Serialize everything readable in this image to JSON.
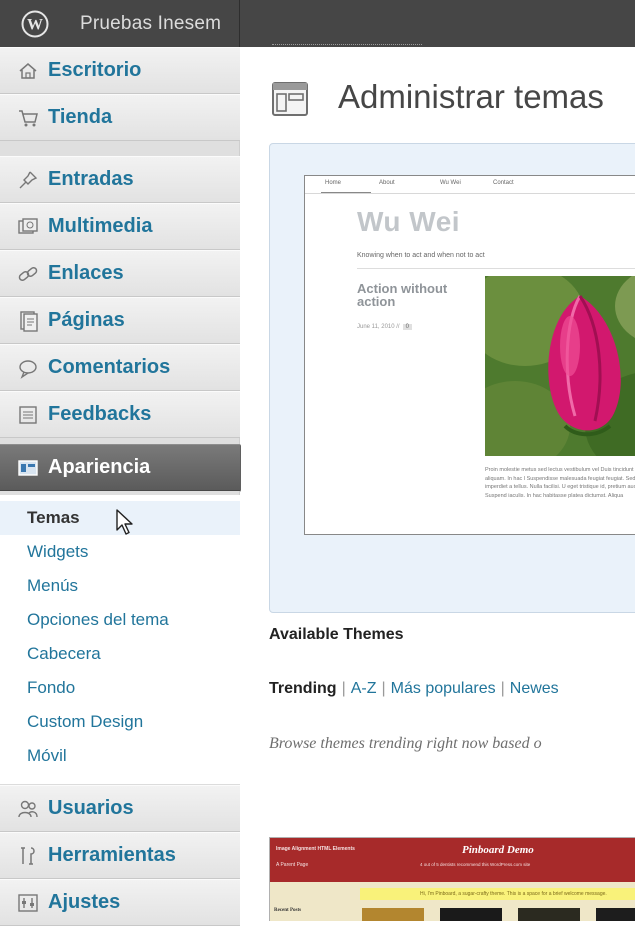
{
  "topbar": {
    "site_name": "Pruebas Inesem",
    "logo_icon": "wordpress-logo-icon"
  },
  "sidebar": {
    "items": [
      {
        "label": "Escritorio",
        "icon": "dashboard-icon"
      },
      {
        "label": "Tienda",
        "icon": "cart-icon"
      },
      {
        "label": "Entradas",
        "icon": "pushpin-icon"
      },
      {
        "label": "Multimedia",
        "icon": "media-icon"
      },
      {
        "label": "Enlaces",
        "icon": "link-icon"
      },
      {
        "label": "Páginas",
        "icon": "pages-icon"
      },
      {
        "label": "Comentarios",
        "icon": "comments-icon"
      },
      {
        "label": "Feedbacks",
        "icon": "feedback-icon"
      },
      {
        "label": "Apariencia",
        "icon": "appearance-icon",
        "active": true
      },
      {
        "label": "Usuarios",
        "icon": "users-icon"
      },
      {
        "label": "Herramientas",
        "icon": "tools-icon"
      },
      {
        "label": "Ajustes",
        "icon": "settings-icon"
      }
    ],
    "submenu": [
      {
        "label": "Temas",
        "current": true
      },
      {
        "label": "Widgets"
      },
      {
        "label": "Menús"
      },
      {
        "label": "Opciones del tema"
      },
      {
        "label": "Cabecera"
      },
      {
        "label": "Fondo"
      },
      {
        "label": "Custom Design"
      },
      {
        "label": "Móvil"
      }
    ]
  },
  "main": {
    "title": "Administrar temas",
    "current_theme": {
      "nav": [
        "Home",
        "About",
        "Wu Wei",
        "Contact"
      ],
      "site_title": "Wu Wei",
      "tagline": "Knowing when to act and when not to act",
      "post_title": "Action without action",
      "post_date": "June 11, 2010 //",
      "post_comments": "0",
      "body_text": "Proin molestie metus sed lectus vestibulum vel Duis tincidunt sagittis tellus et aliquam. In hac l Suspendisse malesuada feugiat feugiat. Sed to commodo at; imperdiet a tellus. Nulla facilisi. U eget tristique id, pretium auctor tortor. Suspend iaculis. In hac habitasse platea dictumst. Aliqua"
    },
    "available_title": "Available Themes",
    "filters": {
      "trending": "Trending",
      "az": "A-Z",
      "popular": "Más populares",
      "newest": "Newes"
    },
    "browse_description": "Browse themes trending right now based o",
    "theme_thumb": {
      "nav_line1": "Image Alignment    HTML Elements",
      "nav_line2": "A Parent Page",
      "title": "Pinboard Demo",
      "subtitle": "4 out of 5 dentists recommend this WordPress.com site",
      "banner": "Hi, I'm Pinboard, a sugar-crafty theme. This is a space for a brief welcome message.",
      "recent": "Recent Posts"
    }
  },
  "colors": {
    "link": "#21759b",
    "topbar": "#464646",
    "active_menu": "#6a6a6a",
    "highlight_bg": "#eaf2fa"
  }
}
